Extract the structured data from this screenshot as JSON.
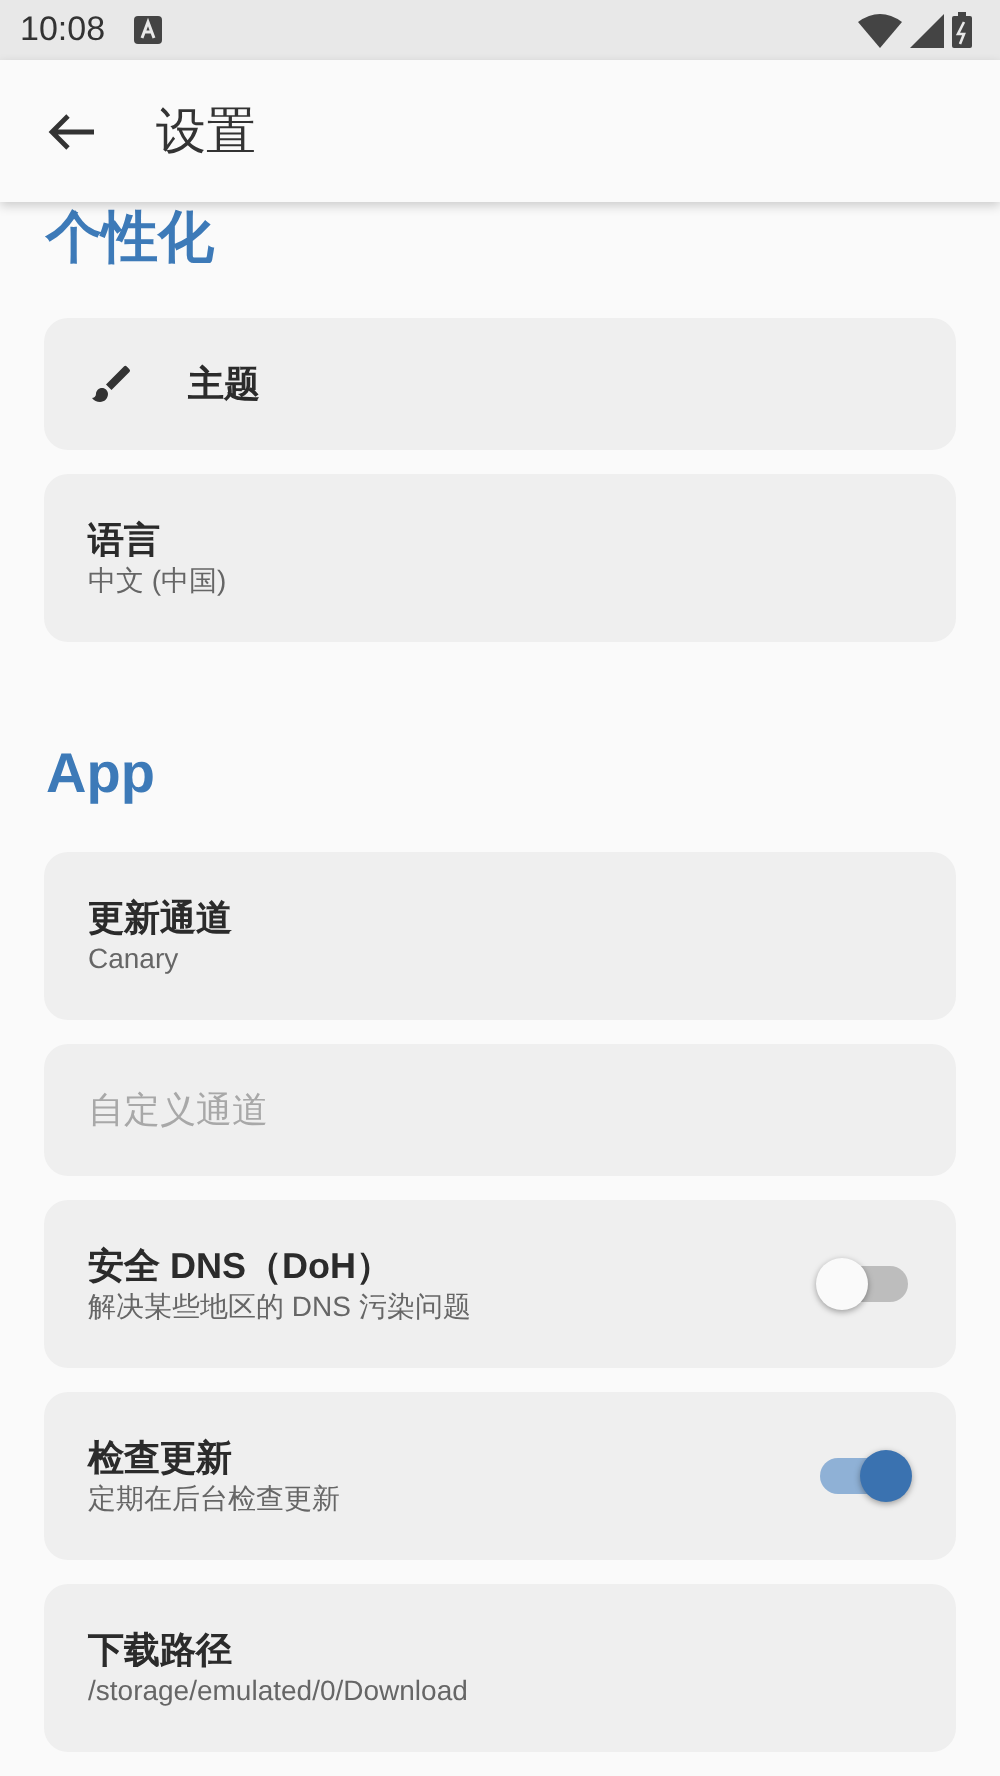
{
  "status_bar": {
    "time": "10:08"
  },
  "app_bar": {
    "title": "设置"
  },
  "sections": [
    {
      "title": "个性化",
      "items": [
        {
          "kind": "icon",
          "title": "主题"
        },
        {
          "kind": "text",
          "title": "语言",
          "subtitle": "中文 (中国)"
        }
      ]
    },
    {
      "title": "App",
      "items": [
        {
          "kind": "text",
          "title": "更新通道",
          "subtitle": "Canary"
        },
        {
          "kind": "text",
          "title": "自定义通道",
          "disabled": true
        },
        {
          "kind": "switch",
          "title": "安全 DNS（DoH）",
          "subtitle": "解决某些地区的 DNS 污染问题",
          "on": false
        },
        {
          "kind": "switch",
          "title": "检查更新",
          "subtitle": "定期在后台检查更新",
          "on": true
        },
        {
          "kind": "text",
          "title": "下载路径",
          "subtitle": "/storage/emulated/0/Download"
        }
      ]
    }
  ]
}
